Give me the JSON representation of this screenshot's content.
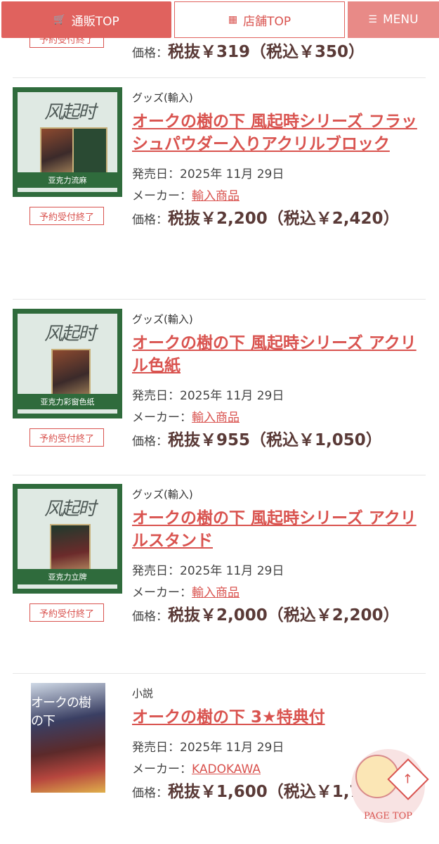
{
  "nav": {
    "mail_label": "通販TOP",
    "store_label": "店舗TOP",
    "menu_label": "MENU"
  },
  "top_partial": {
    "badge": "予約受付終了",
    "price_prefix": "価格：",
    "price_main": "税抜￥319（税込￥350）"
  },
  "items": [
    {
      "category": "グッズ(輸入)",
      "title": "オークの樹の下 風起時シリーズ フラッシュパウダー入りアクリルブロック",
      "release_label": "発売日：",
      "release_date": "2025年 11月 29日",
      "maker_label": "メーカー：",
      "maker": "輸入商品",
      "price_prefix": "価格：",
      "price_main": "税抜￥2,200（税込￥2,420）",
      "badge": "予約受付終了",
      "thumb_logo": "风起时",
      "thumb_caption": "亚克力流麻"
    },
    {
      "category": "グッズ(輸入)",
      "title": "オークの樹の下 風起時シリーズ アクリル色紙",
      "release_label": "発売日：",
      "release_date": "2025年 11月 29日",
      "maker_label": "メーカー：",
      "maker": "輸入商品",
      "price_prefix": "価格：",
      "price_main": "税抜￥955（税込￥1,050）",
      "badge": "予約受付終了",
      "thumb_logo": "风起时",
      "thumb_caption": "亚克力彩窗色纸"
    },
    {
      "category": "グッズ(輸入)",
      "title": "オークの樹の下 風起時シリーズ アクリルスタンド",
      "release_label": "発売日：",
      "release_date": "2025年 11月 29日",
      "maker_label": "メーカー：",
      "maker": "輸入商品",
      "price_prefix": "価格：",
      "price_main": "税抜￥2,000（税込￥2,200）",
      "badge": "予約受付終了",
      "thumb_logo": "风起时",
      "thumb_caption": "亚克力立牌"
    },
    {
      "category": "小説",
      "title": "オークの樹の下 3★特典付",
      "release_label": "発売日：",
      "release_date": "2025年 11月 29日",
      "maker_label": "メーカー：",
      "maker": "KADOKAWA",
      "price_prefix": "価格：",
      "price_main": "税抜￥1,600（税込￥1,760）",
      "book_title": "オークの樹の下"
    }
  ],
  "page_top": {
    "label": "PAGE TOP"
  }
}
